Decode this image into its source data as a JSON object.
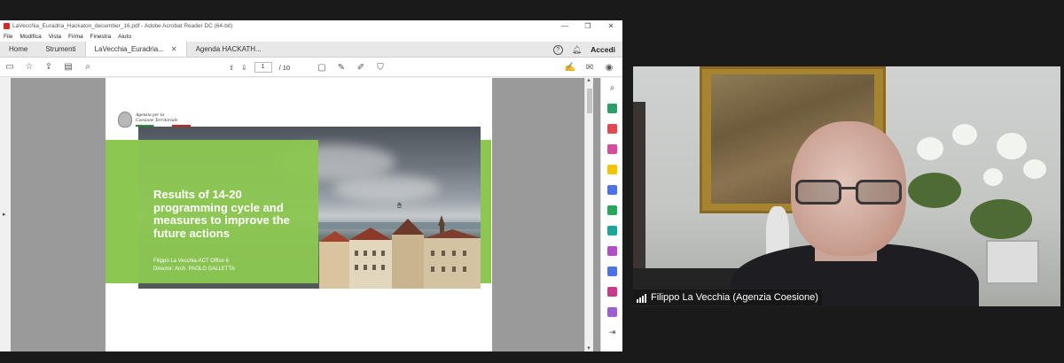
{
  "acrobat": {
    "title": "LaVecchia_Euradria_Hackaton_december_16.pdf - Adobe Acrobat Reader DC (64-bit)",
    "menu": [
      "File",
      "Modifica",
      "Vista",
      "Firma",
      "Finestra",
      "Aiuto"
    ],
    "tabs": {
      "home": "Home",
      "tools": "Strumenti",
      "doc1": "LaVecchia_Euradria...",
      "doc2": "Agenda HACKATH..."
    },
    "help_symbol": "?",
    "signin_label": "Accedi",
    "page_current": "1",
    "page_total": "/ 10"
  },
  "slide": {
    "logo_line1": "Agenzia per la",
    "logo_line2": "Coesione Territoriale",
    "title": "Results of 14-20 programming cycle and measures to improve the future actions",
    "author": "Filippo La Vecchia-ACT Office 6",
    "director": "Director: Arch. PAOLO GALLETTA"
  },
  "video": {
    "participant_name": "Filippo La Vecchia (Agenzia Coesione)"
  },
  "colors": {
    "slide_green": "#8bc751",
    "acrobat_red": "#d42a1f"
  }
}
